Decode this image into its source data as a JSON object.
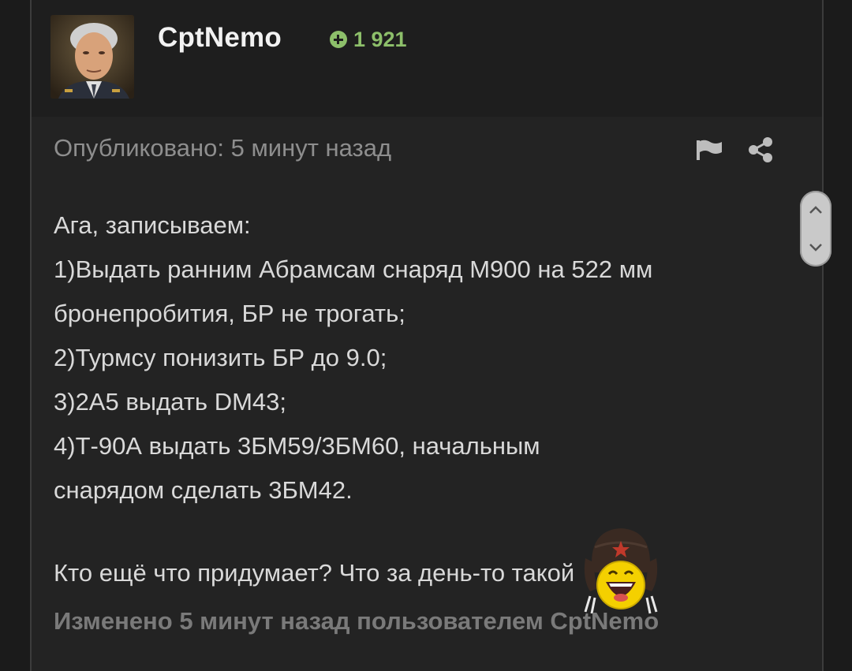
{
  "author": {
    "username": "CptNemo",
    "reputation": "1 921"
  },
  "post": {
    "published": "Опубликовано: 5 минут назад",
    "lines": [
      "Ага, записываем:",
      "1)Выдать ранним Абрамсам снаряд М900 на 522 мм",
      "бронепробития, БР не трогать;",
      "2)Турмсу понизить БР до 9.0;",
      "3)2А5 выдать DM43;",
      "4)Т-90А выдать 3БМ59/3БМ60, начальным",
      "снарядом сделать 3БМ42."
    ],
    "closing": "Кто ещё что придумает? Что за день-то такой",
    "edited": "Изменено 5 минут назад пользователем CptNemo"
  },
  "icons": {
    "reputation": "plus-circle-icon",
    "report": "flag-icon",
    "share": "share-icon",
    "scroll_up": "chevron-up-icon",
    "scroll_down": "chevron-down-icon",
    "emoji": "laughing-soldier-emoji"
  },
  "colors": {
    "background": "#1b1b1b",
    "card": "#232323",
    "header": "#1e1e1e",
    "reputation": "#8dbf6a",
    "text": "#d9d9d9",
    "muted": "#8e8e8e"
  }
}
